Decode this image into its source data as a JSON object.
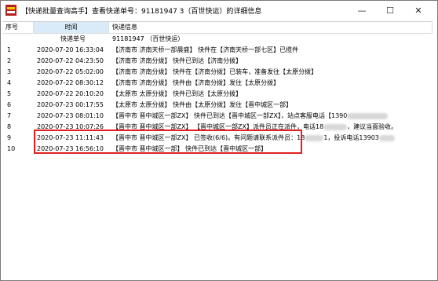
{
  "window": {
    "title": "【快递批量查询高手】查看快递单号：91181947   3（百世快运）的详细信息",
    "close_glyph": "✕",
    "minimize_glyph": "—",
    "maximize_glyph": "☐"
  },
  "columns": [
    "序号",
    "时间",
    "快递信息"
  ],
  "subheader": {
    "label": "快递单号",
    "number": "91181947   （百世快运）"
  },
  "rows": [
    {
      "no": "1",
      "time": "2020-07-20 16:33:04",
      "info": "【济南市 济南天桥一部晨盛】 快件在【济南天桥一部七区】已揽件"
    },
    {
      "no": "2",
      "time": "2020-07-22 04:23:50",
      "info": "【济南市 济南分拨】 快件已到达【济南分拨】"
    },
    {
      "no": "3",
      "time": "2020-07-22 05:02:00",
      "info": "【济南市 济南分拨】 快件在【济南分拨】已装车，准备发往【太原分拨】"
    },
    {
      "no": "4",
      "time": "2020-07-22 08:30:12",
      "info": "【济南市 济南分拨】 快件由【济南分拨】发往【太原分拨】"
    },
    {
      "no": "5",
      "time": "2020-07-22 20:10:20",
      "info": "【太原市 太原分拨】 快件已到达【太原分拨】"
    },
    {
      "no": "6",
      "time": "2020-07-23 00:17:55",
      "info": "【太原市 太原分拨】 快件由【太原分拨】发往【晋中城区一部】"
    },
    {
      "no": "7",
      "time": "2020-07-23 08:01:10",
      "info": "【晋中市 晋中城区一部ZX】 快件已到达【晋中城区一部ZX】，站点客服电话【1390",
      "tail": ""
    },
    {
      "no": "8",
      "time": "2020-07-23 10:07:26",
      "info": "【晋中市 晋中城区一部ZX】 【晋中城区一部ZX】派件员正在派件，电话18",
      "tail": "，建议当面验收。"
    },
    {
      "no": "9",
      "time": "2020-07-23 11:11:43",
      "info": "【晋中市 晋中城区一部ZX】 已签收(6/6)。有问题请联系派件员：18",
      "tail": "1，投诉电话13903"
    },
    {
      "no": "10",
      "time": "2020-07-23 16:56:10",
      "info": "【晋中市 晋中城区一部】 快件已到达【晋中城区一部】"
    }
  ],
  "colors": {
    "highlight": "#e0211f",
    "header_sorted": "#d9ebf9"
  },
  "icons": {
    "app": "courier-app-icon"
  }
}
